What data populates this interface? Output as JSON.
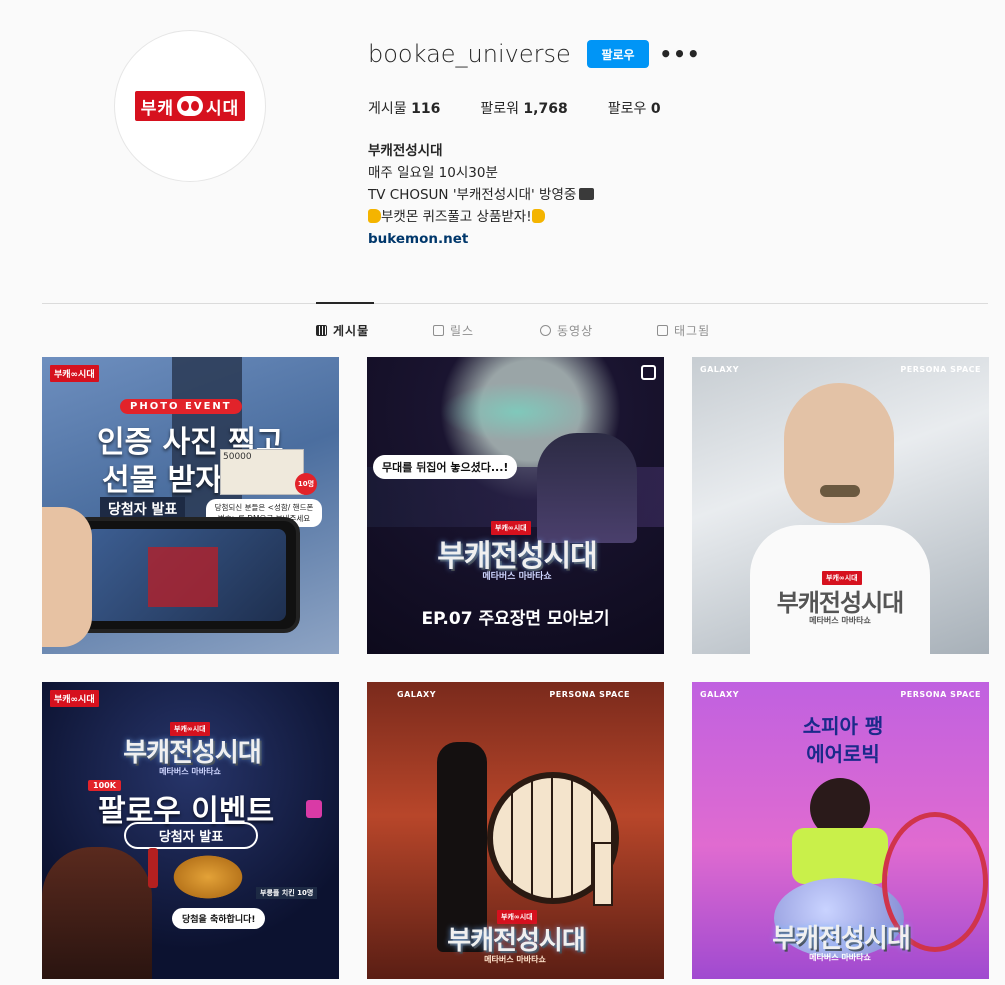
{
  "profile": {
    "username": "bookae_universe",
    "follow_label": "팔로우",
    "more_label": "•••",
    "avatar_logo": "부캐∞시대",
    "stats": [
      {
        "label": "게시물",
        "value": "116"
      },
      {
        "label": "팔로워",
        "value": "1,768"
      },
      {
        "label": "팔로우",
        "value": "0"
      }
    ],
    "bio": {
      "name": "부캐전성시대",
      "line1": "매주 일요일 10시30분",
      "line2": "TV CHOSUN '부캐전성시대' 방영중",
      "line3": "부캣몬 퀴즈풀고 상품받자!",
      "link": "bukemon.net"
    }
  },
  "tabs": [
    {
      "label": "게시물",
      "icon": "grid-icon"
    },
    {
      "label": "릴스",
      "icon": "reels-icon"
    },
    {
      "label": "동영상",
      "icon": "play-icon"
    },
    {
      "label": "태그됨",
      "icon": "tag-icon"
    }
  ],
  "posts": [
    {
      "logo": "부캐∞시대",
      "badge": "PHOTO EVENT",
      "title1": "인증 사진 찍고",
      "title2": "선물 받자",
      "subtitle": "당첨자 발표",
      "bill": "50000",
      "count": "10명",
      "note": "당첨되신 분들은 <성함/ 핸드폰 번호>를 DM으로 보내주세요"
    },
    {
      "bubble": "무대를 뒤집어 놓으셨다...!",
      "mini_logo": "부캐∞시대",
      "show": "부캐전성시대",
      "show_sub": "메타버스 마바타쇼",
      "episode": "EP.07 주요장면 모아보기"
    },
    {
      "brand_left": "GALAXY",
      "brand_right": "PERSONA SPACE",
      "mini_logo": "부캐∞시대",
      "show": "부캐전성시대",
      "show_sub": "메타버스 마바타쇼"
    },
    {
      "logo": "부캐∞시대",
      "mini_logo": "부캐∞시대",
      "show": "부캐전성시대",
      "show_sub": "메타버스 마바타쇼",
      "badge": "100K",
      "title": "팔로우 이벤트",
      "subtitle": "당첨자 발표",
      "prize": "부릉플 치킨 10명",
      "congrats": "당첨을 축하합니다!"
    },
    {
      "brand_left": "GALAXY",
      "brand_right": "PERSONA SPACE",
      "mini_logo": "부캐∞시대",
      "show": "부캐전성시대",
      "show_sub": "메타버스 마바타쇼"
    },
    {
      "brand_left": "GALAXY",
      "brand_right": "PERSONA SPACE",
      "title1": "소피아 팽",
      "title2": "에어로빅",
      "show": "부캐전성시대",
      "show_sub": "메타버스 마바타쇼"
    }
  ]
}
